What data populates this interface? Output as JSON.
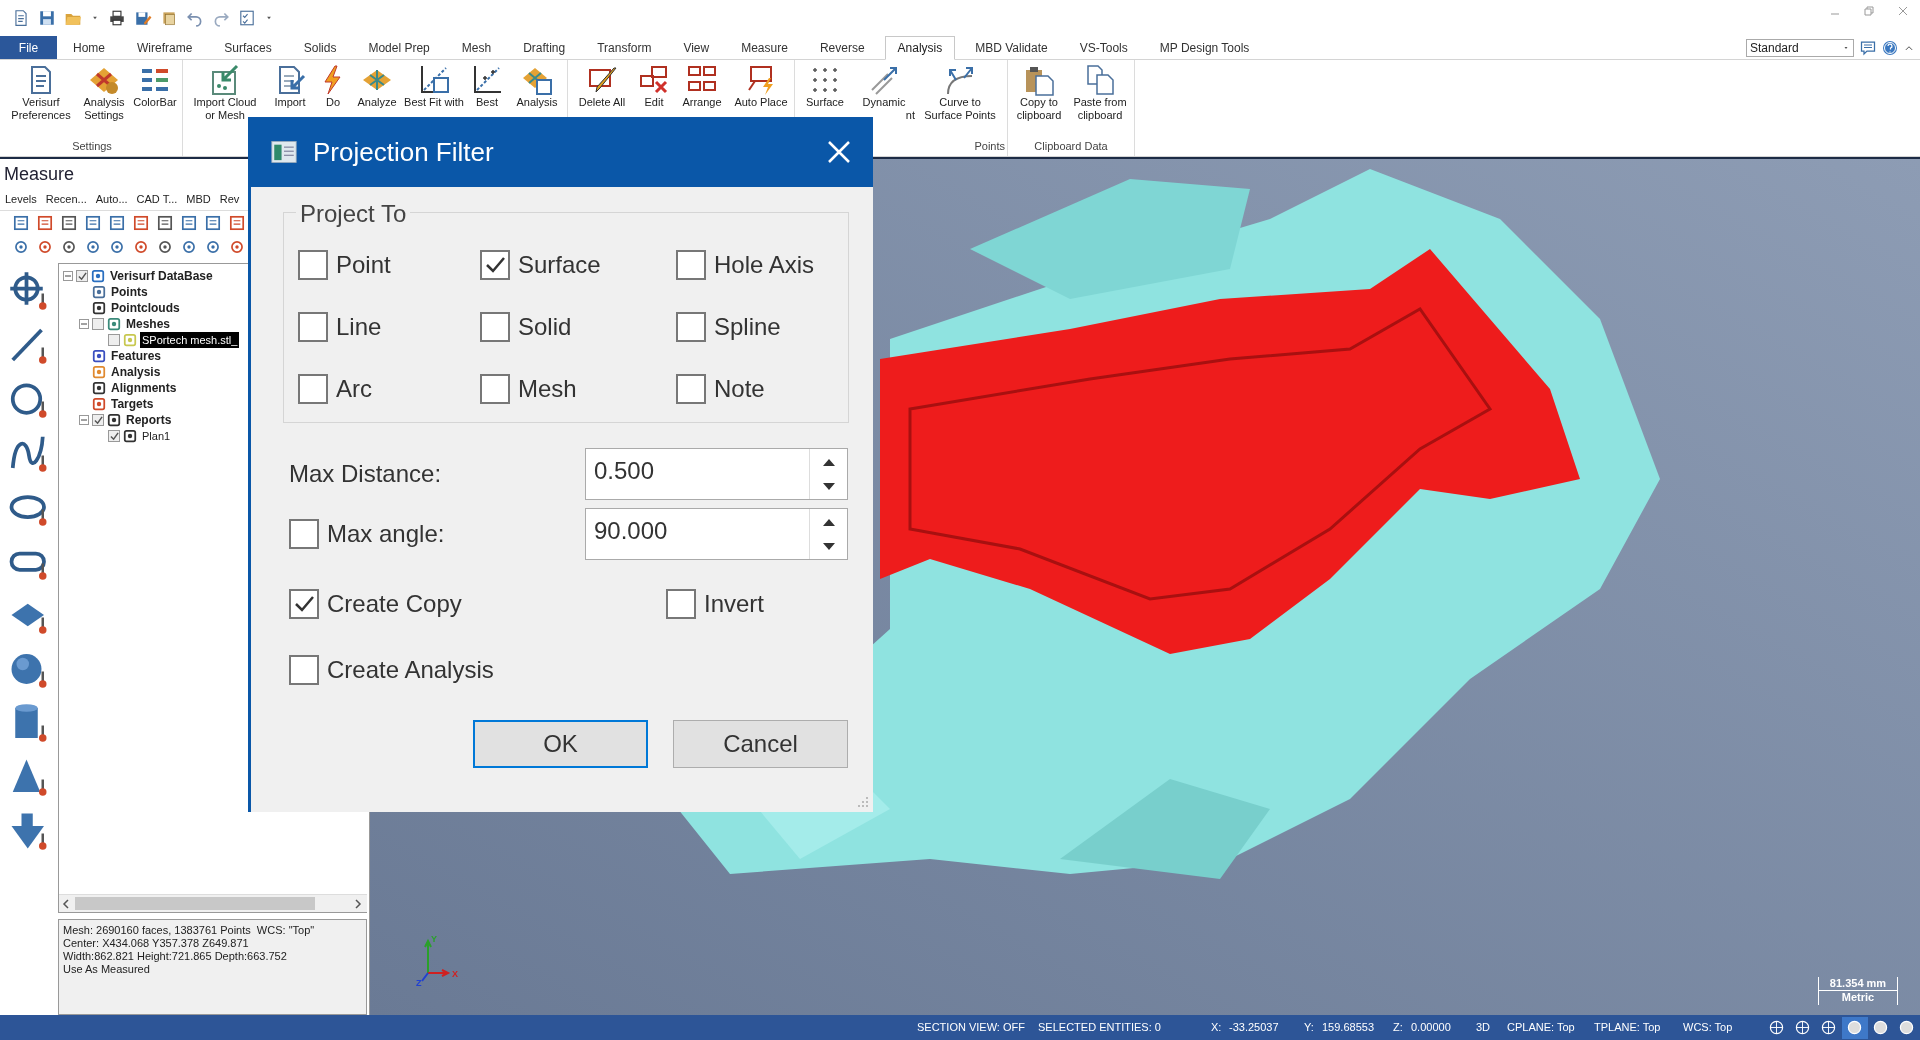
{
  "menu_tabs": [
    {
      "label": "File",
      "kind": "file",
      "selected": false
    },
    {
      "label": "Home",
      "kind": "tab",
      "selected": false
    },
    {
      "label": "Wireframe",
      "kind": "tab",
      "selected": false
    },
    {
      "label": "Surfaces",
      "kind": "tab",
      "selected": false
    },
    {
      "label": "Solids",
      "kind": "tab",
      "selected": false
    },
    {
      "label": "Model Prep",
      "kind": "tab",
      "selected": false
    },
    {
      "label": "Mesh",
      "kind": "tab",
      "selected": false
    },
    {
      "label": "Drafting",
      "kind": "tab",
      "selected": false
    },
    {
      "label": "Transform",
      "kind": "tab",
      "selected": false
    },
    {
      "label": "View",
      "kind": "tab",
      "selected": false
    },
    {
      "label": "Measure",
      "kind": "tab",
      "selected": false
    },
    {
      "label": "Reverse",
      "kind": "tab",
      "selected": false
    },
    {
      "label": "Analysis",
      "kind": "tab",
      "selected": true
    },
    {
      "label": "MBD Validate",
      "kind": "tab",
      "selected": false
    },
    {
      "label": "VS-Tools",
      "kind": "tab",
      "selected": false
    },
    {
      "label": "MP Design Tools",
      "kind": "tab",
      "selected": false
    }
  ],
  "workspace": {
    "value": "Standard"
  },
  "ribbon": {
    "groups": [
      {
        "label": "Settings",
        "buttons": [
          {
            "lines": [
              "Verisurf",
              "Preferences"
            ]
          },
          {
            "lines": [
              "Analysis",
              "Settings"
            ]
          },
          {
            "lines": [
              "ColorBar"
            ]
          }
        ]
      },
      {
        "buttons": [
          {
            "lines": [
              "Import Cloud",
              "or Mesh"
            ]
          },
          {
            "lines": [
              "Import"
            ]
          },
          {
            "lines": [
              "Do"
            ]
          },
          {
            "lines": [
              "Analyze"
            ]
          },
          {
            "lines": [
              "Best Fit with"
            ]
          },
          {
            "lines": [
              "Best"
            ]
          },
          {
            "lines": [
              "Analysis"
            ]
          }
        ]
      },
      {
        "buttons": [
          {
            "lines": [
              "Delete All"
            ]
          },
          {
            "lines": [
              "Edit"
            ]
          },
          {
            "lines": [
              "Arrange"
            ]
          },
          {
            "lines": [
              "Auto Place"
            ]
          }
        ]
      },
      {
        "label": "Points",
        "buttons": [
          {
            "lines": [
              "Surface"
            ]
          },
          {
            "lines": [
              "Dynamic",
              "nt"
            ]
          },
          {
            "lines": [
              "Curve to",
              "Surface Points"
            ]
          }
        ]
      },
      {
        "label": "Clipboard Data",
        "buttons": [
          {
            "lines": [
              "Copy to",
              "clipboard"
            ]
          },
          {
            "lines": [
              "Paste from",
              "clipboard"
            ]
          }
        ]
      }
    ]
  },
  "measure_panel": {
    "title": "Measure",
    "tabs": [
      "Levels",
      "Recen...",
      "Auto...",
      "CAD T...",
      "MBD",
      "Rev"
    ],
    "tree": [
      {
        "label": "Verisurf DataBase",
        "checked": true,
        "expanded": true,
        "children": [
          {
            "label": "Points"
          },
          {
            "label": "Pointclouds"
          },
          {
            "label": "Meshes",
            "checked": false,
            "expanded": true,
            "children": [
              {
                "label": "SPortech mesh.stl_",
                "checked": false,
                "selected": true
              }
            ]
          },
          {
            "label": "Features"
          },
          {
            "label": "Analysis"
          },
          {
            "label": "Alignments"
          },
          {
            "label": "Targets"
          },
          {
            "label": "Reports",
            "checked": true,
            "expanded": true,
            "children": [
              {
                "label": "Plan1",
                "checked": true,
                "selected": false
              }
            ]
          }
        ]
      }
    ],
    "info": [
      "Mesh: 2690160 faces, 1383761 Points  WCS: \"Top\"",
      "Center: X434.068 Y357.378 Z649.871",
      "Width:862.821 Height:721.865 Depth:663.752",
      "Use As Measured"
    ]
  },
  "dialog": {
    "title": "Projection Filter",
    "group": {
      "label": "Project To",
      "options": [
        {
          "label": "Point",
          "checked": false
        },
        {
          "label": "Surface",
          "checked": true
        },
        {
          "label": "Hole Axis",
          "checked": false
        },
        {
          "label": "Line",
          "checked": false
        },
        {
          "label": "Solid",
          "checked": false
        },
        {
          "label": "Spline",
          "checked": false
        },
        {
          "label": "Arc",
          "checked": false
        },
        {
          "label": "Mesh",
          "checked": false
        },
        {
          "label": "Note",
          "checked": false
        }
      ]
    },
    "max_distance": {
      "label": "Max Distance:",
      "value": "0.500"
    },
    "max_angle": {
      "label": "Max angle:",
      "checked": false,
      "value": "90.000"
    },
    "create_copy": {
      "label": "Create Copy",
      "checked": true
    },
    "invert": {
      "label": "Invert",
      "checked": false
    },
    "create_analysis": {
      "label": "Create Analysis",
      "checked": false
    },
    "buttons": [
      {
        "label": "OK",
        "default": true
      },
      {
        "label": "Cancel",
        "default": false
      }
    ]
  },
  "viewport": {
    "axes": [
      "Y",
      "Z",
      "X"
    ],
    "scale_bar": {
      "value": "81.354 mm",
      "units": "Metric"
    }
  },
  "status_bar": [
    "SECTION VIEW: OFF",
    "SELECTED ENTITIES: 0",
    "X:",
    "-33.25037",
    "Y:",
    "159.68553",
    "Z:",
    "0.00000",
    "3D",
    "CPLANE: Top",
    "TPLANE: Top",
    "WCS: Top"
  ]
}
